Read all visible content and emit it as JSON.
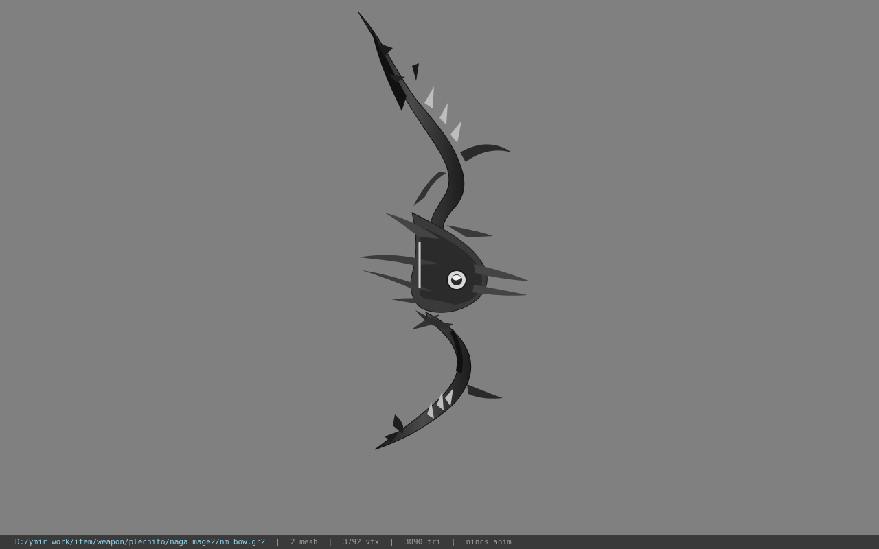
{
  "viewer": {
    "background_color": "#808080",
    "model_icon": "bow-model"
  },
  "status_bar": {
    "file_path": "D:/ymir work/item/weapon/plechito/naga_mage2/nm_bow.gr2",
    "separator": "|",
    "mesh_count": "2 mesh",
    "vertex_count": "3792 vtx",
    "triangle_count": "3090 tri",
    "animation": "nincs anim",
    "path_color": "#8fd0e8",
    "text_color": "#9a9a9a"
  }
}
